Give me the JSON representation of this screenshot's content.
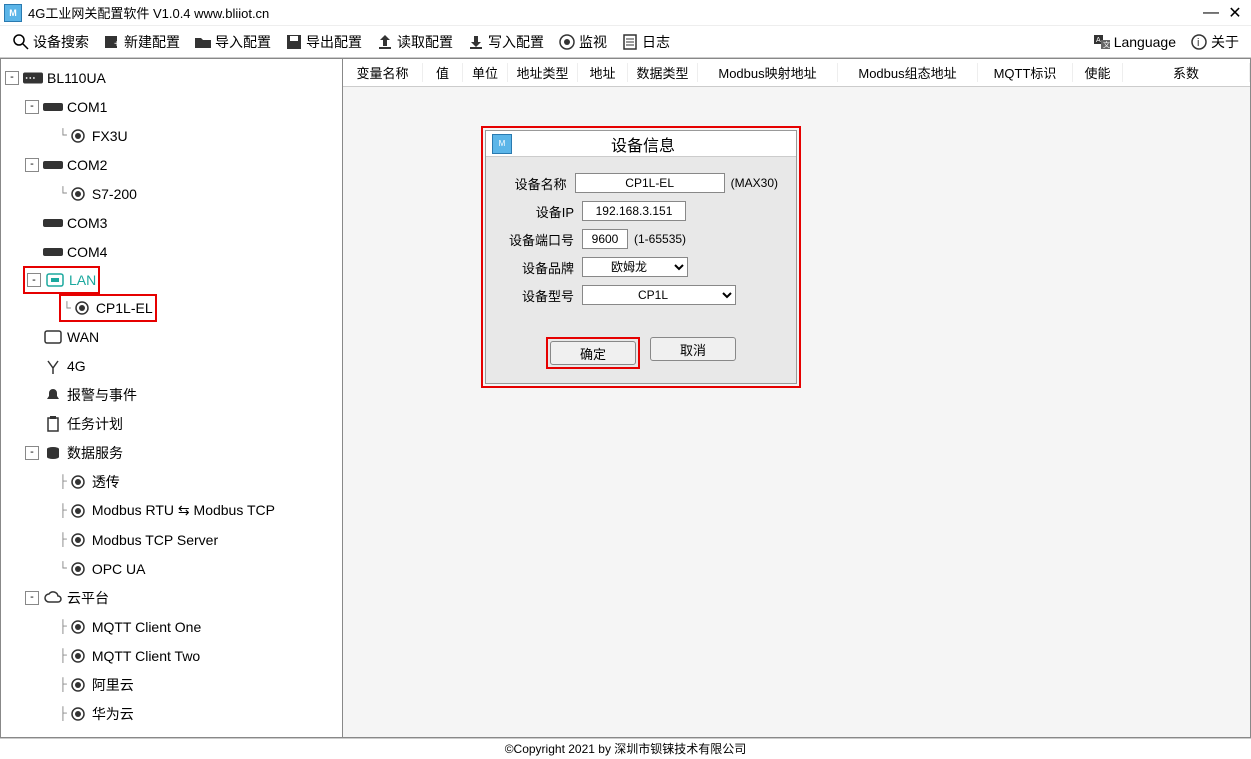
{
  "titlebar": {
    "title": "4G工业网关配置软件 V1.0.4 www.bliiot.cn"
  },
  "toolbar": {
    "search": "设备搜索",
    "new": "新建配置",
    "import": "导入配置",
    "export": "导出配置",
    "read": "读取配置",
    "write": "写入配置",
    "monitor": "监视",
    "log": "日志",
    "language": "Language",
    "about": "关于"
  },
  "tree": {
    "root": "BL110UA",
    "com1": "COM1",
    "fx3u": "FX3U",
    "com2": "COM2",
    "s7200": "S7-200",
    "com3": "COM3",
    "com4": "COM4",
    "lan": "LAN",
    "cp1lel": "CP1L-EL",
    "wan": "WAN",
    "fourg": "4G",
    "alarm": "报警与事件",
    "task": "任务计划",
    "dataservice": "数据服务",
    "passthrough": "透传",
    "modbusrtutcp": "Modbus RTU ⇆ Modbus TCP",
    "modbustcpserver": "Modbus TCP Server",
    "opcua": "OPC UA",
    "cloud": "云平台",
    "mqtt1": "MQTT Client One",
    "mqtt2": "MQTT Client Two",
    "aliyun": "阿里云",
    "huawei": "华为云"
  },
  "columns": {
    "c1": "变量名称",
    "c2": "值",
    "c3": "单位",
    "c4": "地址类型",
    "c5": "地址",
    "c6": "数据类型",
    "c7": "Modbus映射地址",
    "c8": "Modbus组态地址",
    "c9": "MQTT标识",
    "c10": "使能",
    "c11": "系数"
  },
  "dialog": {
    "title": "设备信息",
    "name_label": "设备名称",
    "name_value": "CP1L-EL",
    "name_hint": "(MAX30)",
    "ip_label": "设备IP",
    "ip_value": "192.168.3.151",
    "port_label": "设备端口号",
    "port_value": "9600",
    "port_hint": "(1-65535)",
    "brand_label": "设备品牌",
    "brand_value": "欧姆龙",
    "model_label": "设备型号",
    "model_value": "CP1L",
    "ok": "确定",
    "cancel": "取消"
  },
  "footer": {
    "copyright": "©Copyright 2021 by 深圳市钡铼技术有限公司"
  }
}
